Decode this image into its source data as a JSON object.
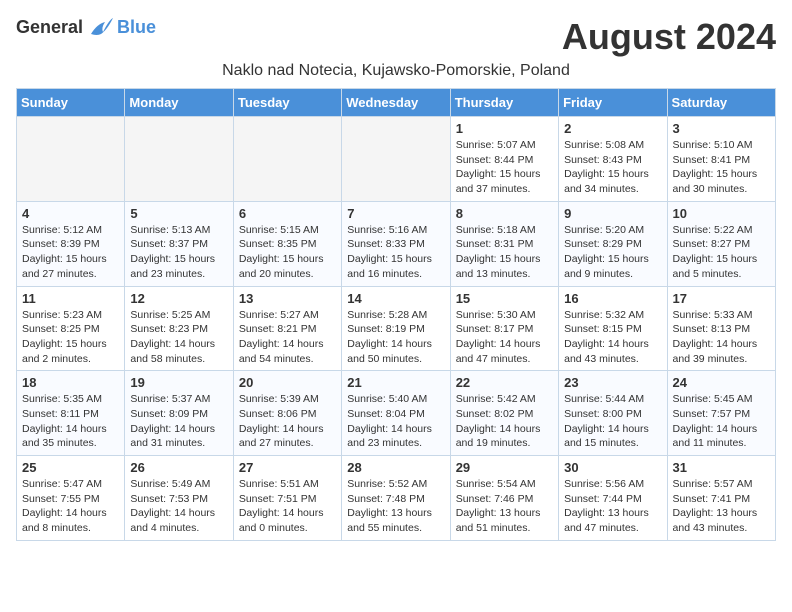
{
  "logo": {
    "general": "General",
    "blue": "Blue"
  },
  "title": "August 2024",
  "subtitle": "Naklo nad Notecia, Kujawsko-Pomorskie, Poland",
  "weekdays": [
    "Sunday",
    "Monday",
    "Tuesday",
    "Wednesday",
    "Thursday",
    "Friday",
    "Saturday"
  ],
  "weeks": [
    [
      {
        "day": "",
        "info": ""
      },
      {
        "day": "",
        "info": ""
      },
      {
        "day": "",
        "info": ""
      },
      {
        "day": "",
        "info": ""
      },
      {
        "day": "1",
        "info": "Sunrise: 5:07 AM\nSunset: 8:44 PM\nDaylight: 15 hours\nand 37 minutes."
      },
      {
        "day": "2",
        "info": "Sunrise: 5:08 AM\nSunset: 8:43 PM\nDaylight: 15 hours\nand 34 minutes."
      },
      {
        "day": "3",
        "info": "Sunrise: 5:10 AM\nSunset: 8:41 PM\nDaylight: 15 hours\nand 30 minutes."
      }
    ],
    [
      {
        "day": "4",
        "info": "Sunrise: 5:12 AM\nSunset: 8:39 PM\nDaylight: 15 hours\nand 27 minutes."
      },
      {
        "day": "5",
        "info": "Sunrise: 5:13 AM\nSunset: 8:37 PM\nDaylight: 15 hours\nand 23 minutes."
      },
      {
        "day": "6",
        "info": "Sunrise: 5:15 AM\nSunset: 8:35 PM\nDaylight: 15 hours\nand 20 minutes."
      },
      {
        "day": "7",
        "info": "Sunrise: 5:16 AM\nSunset: 8:33 PM\nDaylight: 15 hours\nand 16 minutes."
      },
      {
        "day": "8",
        "info": "Sunrise: 5:18 AM\nSunset: 8:31 PM\nDaylight: 15 hours\nand 13 minutes."
      },
      {
        "day": "9",
        "info": "Sunrise: 5:20 AM\nSunset: 8:29 PM\nDaylight: 15 hours\nand 9 minutes."
      },
      {
        "day": "10",
        "info": "Sunrise: 5:22 AM\nSunset: 8:27 PM\nDaylight: 15 hours\nand 5 minutes."
      }
    ],
    [
      {
        "day": "11",
        "info": "Sunrise: 5:23 AM\nSunset: 8:25 PM\nDaylight: 15 hours\nand 2 minutes."
      },
      {
        "day": "12",
        "info": "Sunrise: 5:25 AM\nSunset: 8:23 PM\nDaylight: 14 hours\nand 58 minutes."
      },
      {
        "day": "13",
        "info": "Sunrise: 5:27 AM\nSunset: 8:21 PM\nDaylight: 14 hours\nand 54 minutes."
      },
      {
        "day": "14",
        "info": "Sunrise: 5:28 AM\nSunset: 8:19 PM\nDaylight: 14 hours\nand 50 minutes."
      },
      {
        "day": "15",
        "info": "Sunrise: 5:30 AM\nSunset: 8:17 PM\nDaylight: 14 hours\nand 47 minutes."
      },
      {
        "day": "16",
        "info": "Sunrise: 5:32 AM\nSunset: 8:15 PM\nDaylight: 14 hours\nand 43 minutes."
      },
      {
        "day": "17",
        "info": "Sunrise: 5:33 AM\nSunset: 8:13 PM\nDaylight: 14 hours\nand 39 minutes."
      }
    ],
    [
      {
        "day": "18",
        "info": "Sunrise: 5:35 AM\nSunset: 8:11 PM\nDaylight: 14 hours\nand 35 minutes."
      },
      {
        "day": "19",
        "info": "Sunrise: 5:37 AM\nSunset: 8:09 PM\nDaylight: 14 hours\nand 31 minutes."
      },
      {
        "day": "20",
        "info": "Sunrise: 5:39 AM\nSunset: 8:06 PM\nDaylight: 14 hours\nand 27 minutes."
      },
      {
        "day": "21",
        "info": "Sunrise: 5:40 AM\nSunset: 8:04 PM\nDaylight: 14 hours\nand 23 minutes."
      },
      {
        "day": "22",
        "info": "Sunrise: 5:42 AM\nSunset: 8:02 PM\nDaylight: 14 hours\nand 19 minutes."
      },
      {
        "day": "23",
        "info": "Sunrise: 5:44 AM\nSunset: 8:00 PM\nDaylight: 14 hours\nand 15 minutes."
      },
      {
        "day": "24",
        "info": "Sunrise: 5:45 AM\nSunset: 7:57 PM\nDaylight: 14 hours\nand 11 minutes."
      }
    ],
    [
      {
        "day": "25",
        "info": "Sunrise: 5:47 AM\nSunset: 7:55 PM\nDaylight: 14 hours\nand 8 minutes."
      },
      {
        "day": "26",
        "info": "Sunrise: 5:49 AM\nSunset: 7:53 PM\nDaylight: 14 hours\nand 4 minutes."
      },
      {
        "day": "27",
        "info": "Sunrise: 5:51 AM\nSunset: 7:51 PM\nDaylight: 14 hours\nand 0 minutes."
      },
      {
        "day": "28",
        "info": "Sunrise: 5:52 AM\nSunset: 7:48 PM\nDaylight: 13 hours\nand 55 minutes."
      },
      {
        "day": "29",
        "info": "Sunrise: 5:54 AM\nSunset: 7:46 PM\nDaylight: 13 hours\nand 51 minutes."
      },
      {
        "day": "30",
        "info": "Sunrise: 5:56 AM\nSunset: 7:44 PM\nDaylight: 13 hours\nand 47 minutes."
      },
      {
        "day": "31",
        "info": "Sunrise: 5:57 AM\nSunset: 7:41 PM\nDaylight: 13 hours\nand 43 minutes."
      }
    ]
  ]
}
